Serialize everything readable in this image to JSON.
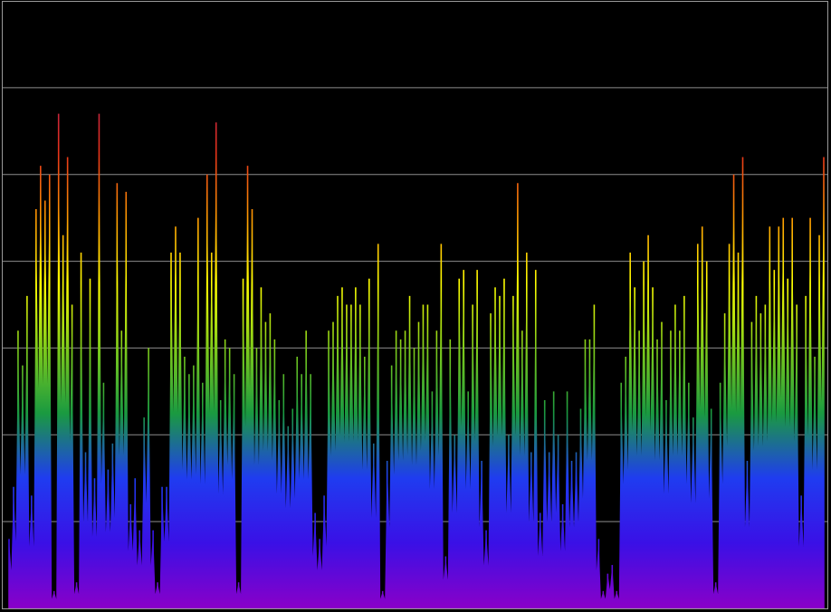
{
  "chart_data": {
    "type": "area",
    "title": "",
    "xlabel": "",
    "ylabel": "",
    "grid": true,
    "ylim": [
      0,
      7
    ],
    "gridlines": [
      1,
      2,
      3,
      4,
      5,
      6
    ],
    "fill_gradient": [
      "#8a00c8",
      "#3a10e6",
      "#1f3cf0",
      "#1a9a40",
      "#7fcc1a",
      "#ffff00",
      "#ff9a00",
      "#e8321a",
      "#b01c50"
    ],
    "values": [
      0.8,
      1.4,
      3.2,
      2.8,
      3.6,
      1.3,
      4.6,
      5.1,
      4.7,
      5.0,
      0.2,
      5.7,
      4.3,
      5.2,
      3.5,
      0.3,
      4.1,
      1.8,
      3.8,
      1.5,
      5.7,
      2.6,
      1.6,
      1.9,
      4.9,
      3.2,
      4.8,
      1.2,
      1.5,
      0.9,
      2.2,
      3.0,
      0.9,
      0.3,
      1.4,
      1.4,
      4.1,
      4.4,
      4.1,
      2.9,
      2.7,
      2.8,
      4.5,
      2.6,
      5.0,
      4.1,
      5.6,
      2.4,
      3.1,
      3.0,
      2.7,
      0.3,
      3.8,
      5.1,
      4.6,
      3.0,
      3.7,
      3.3,
      3.4,
      3.1,
      2.4,
      2.7,
      2.1,
      2.3,
      2.9,
      2.7,
      3.2,
      2.7,
      1.1,
      0.8,
      1.3,
      3.2,
      3.3,
      3.6,
      3.7,
      3.5,
      3.5,
      3.7,
      3.5,
      2.9,
      3.8,
      1.9,
      4.2,
      0.2,
      1.7,
      2.8,
      3.2,
      3.1,
      3.2,
      3.6,
      3.0,
      3.3,
      3.5,
      3.5,
      2.5,
      3.2,
      4.2,
      0.6,
      3.1,
      2.0,
      3.8,
      3.9,
      2.5,
      3.5,
      3.9,
      1.7,
      0.9,
      3.4,
      3.7,
      3.6,
      3.8,
      2.0,
      3.6,
      4.9,
      3.2,
      4.1,
      1.8,
      3.9,
      1.1,
      2.4,
      1.8,
      2.5,
      2.0,
      1.2,
      2.5,
      1.7,
      1.8,
      2.3,
      3.1,
      3.1,
      3.5,
      0.8,
      0.2,
      0.4,
      0.5,
      0.2,
      2.6,
      2.9,
      4.1,
      3.7,
      3.2,
      4.0,
      4.3,
      3.7,
      3.1,
      3.3,
      2.4,
      3.2,
      3.5,
      3.2,
      3.6,
      2.6,
      2.2,
      4.2,
      4.4,
      4.0,
      2.3,
      0.3,
      2.6,
      3.4,
      4.2,
      5.0,
      4.1,
      5.2,
      1.7,
      3.3,
      3.6,
      3.4,
      3.5,
      4.4,
      3.9,
      4.4,
      4.5,
      3.8,
      4.5,
      3.5,
      1.3,
      3.6,
      4.5,
      2.9,
      4.3,
      5.2
    ]
  }
}
